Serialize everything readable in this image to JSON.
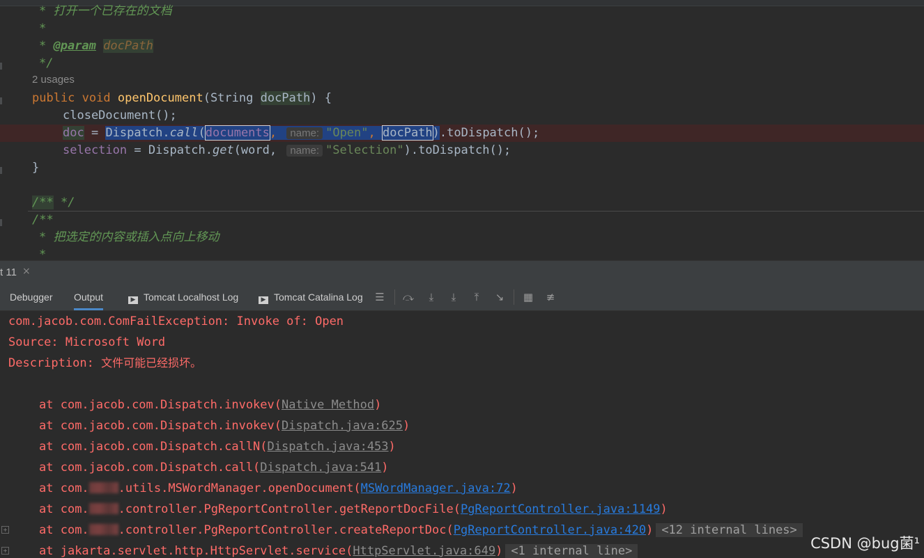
{
  "editor": {
    "lines": {
      "l1": "* 打开一个已存在的文档",
      "l2": "*",
      "l3_star": "* ",
      "l3_tag": "@param",
      "l3_param": "docPath",
      "l4": "*/",
      "usages": "2 usages",
      "l6_kw1": "public",
      "l6_kw2": "void",
      "l6_fn": "openDocument",
      "l6_rest1": "(String ",
      "l6_param": "docPath",
      "l6_rest2": ") {",
      "l7": "closeDocument();",
      "l8_doc": "doc",
      "l8_eq": " = ",
      "l8_sel": "Dispatch.",
      "l8_call": "call",
      "l8_p1": "(",
      "l8_documents": "documents",
      "l8_comma": ",",
      "l8_hint": "name:",
      "l8_open": "\"Open\"",
      "l8_comma2": ", ",
      "l8_docpath": "docPath",
      "l8_paren": ")",
      "l8_rest": ".toDispatch();",
      "l9_sel": "selection",
      "l9_eq": " = Dispatch.",
      "l9_get": "get",
      "l9_p": "(word,",
      "l9_hint": "name:",
      "l9_str": "\"Selection\"",
      "l9_rest": ").toDispatch();",
      "l10": "}",
      "l12_a": "/**",
      "l12_b": " */",
      "l13": "/**",
      "l14": "* 把选定的内容或插入点向上移动",
      "l15": "*"
    }
  },
  "tabstrip": {
    "title": "t 11",
    "close": "×"
  },
  "toolbar": {
    "tabs": [
      "Debugger",
      "Output",
      "Tomcat Localhost Log",
      "Tomcat Catalina Log"
    ],
    "active_tab": "Output",
    "icons": [
      "menu-icon",
      "scroll-to-end-icon",
      "step-over-icon",
      "step-into-icon",
      "step-out-icon",
      "run-to-cursor-icon",
      "table-icon",
      "settings-icon"
    ]
  },
  "console": {
    "lines": {
      "c1": "com.jacob.com.ComFailException: Invoke of: Open",
      "c2": "Source: Microsoft Word",
      "c3_label": "Description: ",
      "c3_msg": "文件可能已经损坏。",
      "at": "at ",
      "s1_pre": "com.jacob.com.Dispatch.invokev(",
      "s1_link": "Native Method",
      "s2_pre": "com.jacob.com.Dispatch.invokev(",
      "s2_link": "Dispatch.java:625",
      "s3_pre": "com.jacob.com.Dispatch.callN(",
      "s3_link": "Dispatch.java:453",
      "s4_pre": "com.jacob.com.Dispatch.call(",
      "s4_link": "Dispatch.java:541",
      "s5_pre": "com.",
      "s5_mid": ".utils.MSWordManager.openDocument(",
      "s5_link": "MSWordManager.java:72",
      "s6_pre": "com.",
      "s6_mid": ".controller.PgReportController.getReportDocFile(",
      "s6_link": "PgReportController.java:1149",
      "s7_pre": "com.",
      "s7_mid": ".controller.PgReportController.createReportDoc(",
      "s7_link": "PgReportController.java:420",
      "s7_fold": "<12 internal lines>",
      "s8_pre": "jakarta.servlet.http.HttpServlet.service(",
      "s8_link": "HttpServlet.java:649",
      "s8_fold": "<1 internal line>",
      "close_paren": ")"
    }
  },
  "watermark": "CSDN @bug菌¹"
}
